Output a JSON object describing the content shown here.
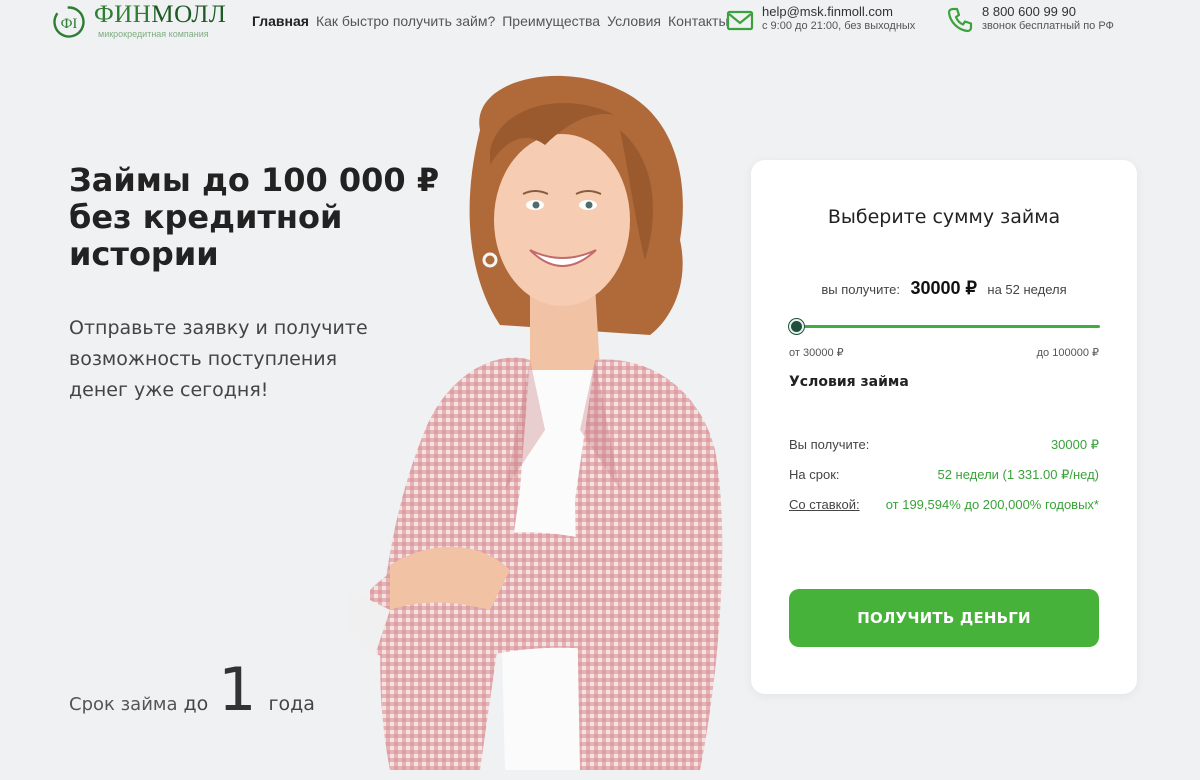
{
  "header": {
    "logo": {
      "name_green": "ФИН",
      "name_dark": "МОЛЛ",
      "subtitle": "микрокредитная компания"
    },
    "nav": [
      "Главная",
      "Как быстро получить займ?",
      "Преимущества",
      "Условия",
      "Контакты"
    ],
    "email": {
      "address": "help@msk.finmoll.com",
      "hours": "с 9:00 до 21:00, без выходных"
    },
    "phone": {
      "number": "8 800 600 99 90",
      "note": "звонок бесплатный по РФ"
    }
  },
  "hero": {
    "title_lines": [
      "Займы до 100 000 ₽",
      "без кредитной",
      "истории"
    ],
    "subtitle_lines": [
      "Отправьте заявку и получите",
      "возможность поступления",
      "денег уже сегодня!"
    ],
    "term": {
      "label": "Срок займа",
      "prefix": "до",
      "number": "1",
      "unit": "года"
    }
  },
  "calculator": {
    "title": "Выберите сумму займа",
    "receive_label": "вы получите:",
    "amount": "30000 ₽",
    "period": "на 52 неделя",
    "slider": {
      "min_label": "от 30000 ₽",
      "max_label": "до 100000 ₽",
      "value_fraction": 0
    },
    "conditions_title": "Условия займа",
    "rows": [
      {
        "key": "Вы получите:",
        "value": "30000 ₽"
      },
      {
        "key": "На срок:",
        "value": "52 недели (1 331.00 ₽/нед)"
      },
      {
        "key": "Со ставкой:",
        "value": "от 199,594% до 200,000% годовых*"
      }
    ],
    "button_label": "ПОЛУЧИТЬ ДЕНЬГИ"
  },
  "colors": {
    "brand_green": "#47b23a",
    "value_green": "#3aa23a",
    "slider_thumb": "#1f4f3f",
    "background": "#f0f1f3"
  }
}
